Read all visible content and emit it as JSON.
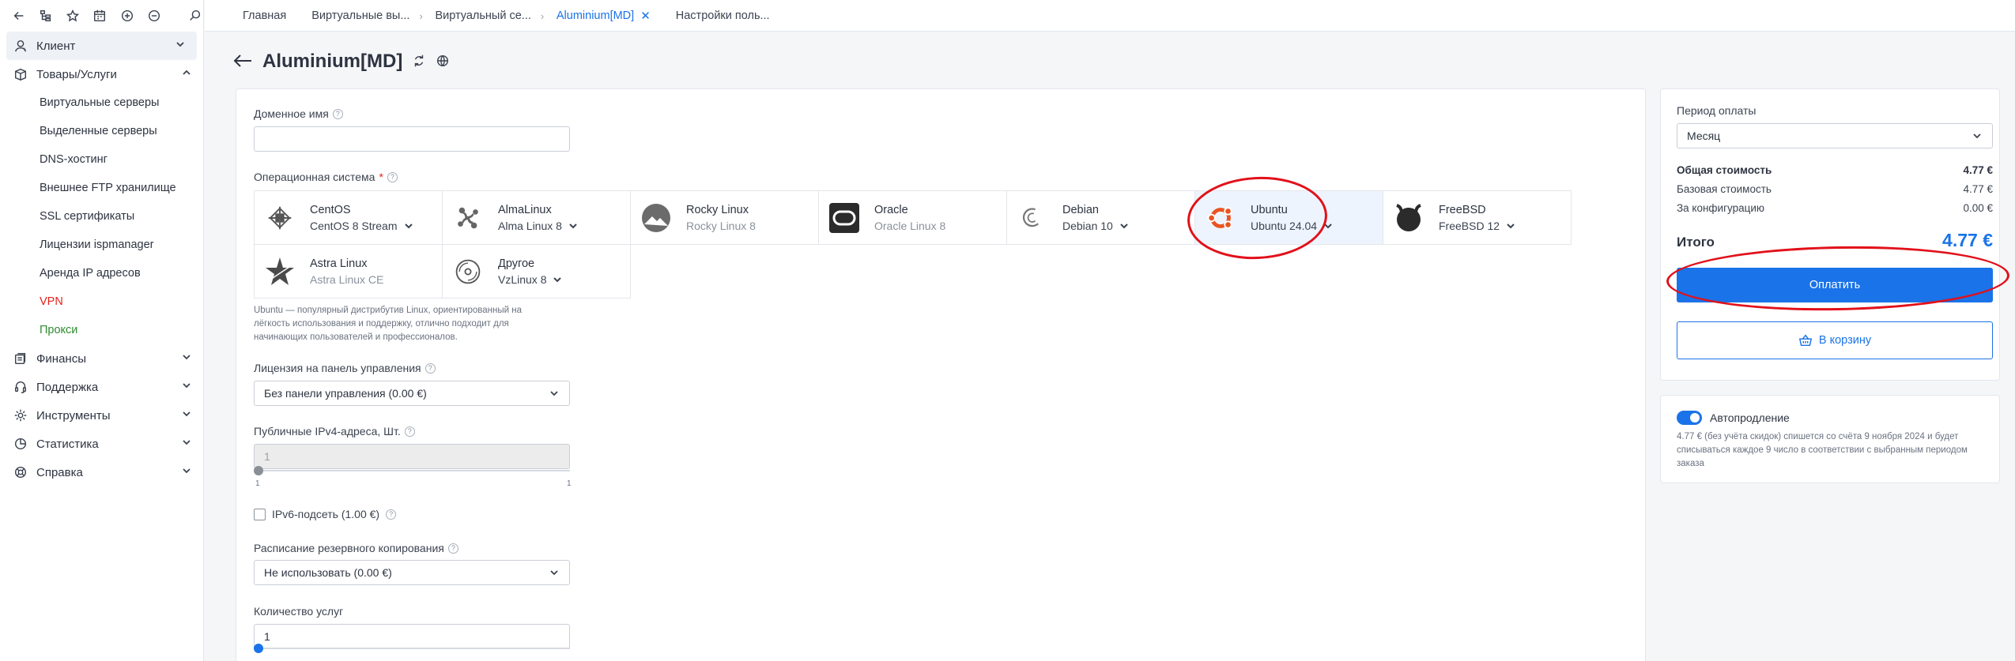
{
  "sidebar": {
    "items": [
      {
        "label": "Клиент",
        "icon": "user-icon"
      },
      {
        "label": "Товары/Услуги",
        "icon": "box-icon"
      },
      {
        "label": "Финансы",
        "icon": "wallet-icon"
      },
      {
        "label": "Поддержка",
        "icon": "headset-icon"
      },
      {
        "label": "Инструменты",
        "icon": "gear-icon"
      },
      {
        "label": "Статистика",
        "icon": "pie-chart-icon"
      },
      {
        "label": "Справка",
        "icon": "lifebuoy-icon"
      }
    ],
    "sub_items": [
      "Виртуальные серверы",
      "Выделенные серверы",
      "DNS-хостинг",
      "Внешнее FTP хранилище",
      "SSL сертификаты",
      "Лицензии ispmanager",
      "Аренда IP адресов",
      "VPN",
      "Прокси"
    ]
  },
  "tabs": [
    {
      "label": "Главная"
    },
    {
      "label": "Виртуальные вы..."
    },
    {
      "label": "Виртуальный се..."
    },
    {
      "label": "Aluminium[MD]"
    },
    {
      "label": "Настройки поль..."
    }
  ],
  "header": {
    "title": "Aluminium[MD]"
  },
  "form": {
    "domain_label": "Доменное имя",
    "domain_value": "",
    "os_label": "Операционная система",
    "os_tiles": [
      {
        "name": "CentOS",
        "version": "CentOS 8 Stream",
        "dropdown": true,
        "icon": "centos-logo-icon"
      },
      {
        "name": "AlmaLinux",
        "version": "Alma Linux 8",
        "dropdown": true,
        "icon": "almalinux-logo-icon"
      },
      {
        "name": "Rocky Linux",
        "version": "Rocky Linux 8",
        "dropdown": false,
        "icon": "rocky-linux-logo-icon"
      },
      {
        "name": "Oracle",
        "version": "Oracle Linux 8",
        "dropdown": false,
        "icon": "oracle-logo-icon"
      },
      {
        "name": "Debian",
        "version": "Debian 10",
        "dropdown": true,
        "icon": "debian-logo-icon"
      },
      {
        "name": "Ubuntu",
        "version": "Ubuntu 24.04",
        "dropdown": true,
        "icon": "ubuntu-logo-icon"
      },
      {
        "name": "FreeBSD",
        "version": "FreeBSD 12",
        "dropdown": true,
        "icon": "freebsd-logo-icon"
      },
      {
        "name": "Astra Linux",
        "version": "Astra Linux CE",
        "dropdown": false,
        "icon": "astra-linux-logo-icon"
      },
      {
        "name": "Другое",
        "version": "VzLinux 8",
        "dropdown": true,
        "icon": "disc-icon"
      }
    ],
    "os_description": "Ubuntu — популярный дистрибутив Linux, ориентированный на лёгкость использования и поддержку, отлично подходит для начинающих пользователей и профессионалов.",
    "license_label": "Лицензия на панель управления",
    "license_value": "Без панели управления (0.00 €)",
    "ipv4_label": "Публичные IPv4-адреса, Шт.",
    "ipv4_value": "1",
    "ipv4_min": "1",
    "ipv4_max": "1",
    "ipv6_label": "IPv6-подсеть (1.00 €)",
    "backup_label": "Расписание резервного копирования",
    "backup_value": "Не использовать (0.00 €)",
    "qty_label": "Количество услуг",
    "qty_value": "1"
  },
  "summary": {
    "period_label": "Период оплаты",
    "period_value": "Месяц",
    "total_cost_label": "Общая стоимость",
    "total_cost_value": "4.77 €",
    "base_cost_label": "Базовая стоимость",
    "base_cost_value": "4.77 €",
    "config_label": "За конфигурацию",
    "config_value": "0.00 €",
    "grand_total_label": "Итого",
    "grand_total_value": "4.77 €",
    "pay_label": "Оплатить",
    "cart_label": "В корзину"
  },
  "autorenew": {
    "title": "Автопродление",
    "enabled": true,
    "text": "4.77 € (без учёта скидок) спишется со счёта 9 ноября 2024 и будет списываться каждое 9 число в соответствии с выбранным периодом заказа"
  },
  "colors": {
    "accent": "#1a73e8",
    "annotation": "#e2101a",
    "vpn": "#e2231a",
    "proxy": "#2e8b2e"
  }
}
